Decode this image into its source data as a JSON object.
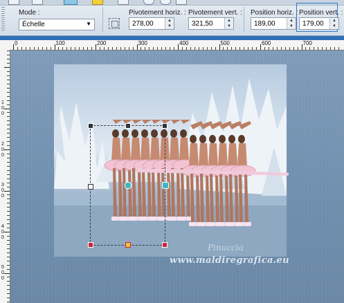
{
  "toolbar": {
    "mode_label": "Mode :",
    "mode_value": "Échelle",
    "fields": [
      {
        "label": "Pivotement horiz. :",
        "value": "278,00"
      },
      {
        "label": "Pivotement vert. :",
        "value": "321,50"
      },
      {
        "label": "Position horiz. :",
        "value": "189,00"
      },
      {
        "label": "Position vert. :",
        "value": "179,00"
      }
    ]
  },
  "ruler": {
    "h_labels": [
      "0",
      "100",
      "200",
      "300",
      "400",
      "500",
      "600",
      "700"
    ],
    "v_labels": [
      "1\n0\n0",
      "2\n0\n0",
      "3\n0\n0",
      "4\n0\n0",
      "5\n0\n0"
    ]
  },
  "watermark": {
    "line1": "Pinuccia",
    "line2": "www.maldiregrafica.eu"
  },
  "colors": {
    "accent": "#2f6fb6",
    "handle": "#d0203a",
    "canvas_bg": "#6f8ead"
  }
}
